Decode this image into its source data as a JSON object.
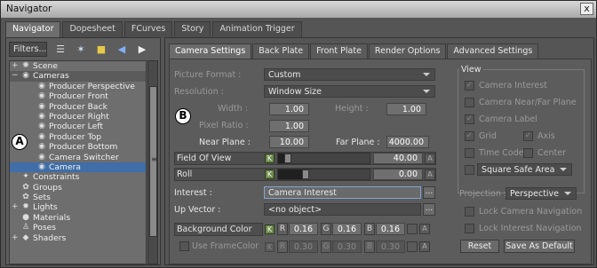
{
  "window": {
    "title": "Navigator",
    "close_glyph": "x"
  },
  "main_tabs": [
    {
      "label": "Navigator",
      "active": true
    },
    {
      "label": "Dopesheet",
      "active": false
    },
    {
      "label": "FCurves",
      "active": false
    },
    {
      "label": "Story",
      "active": false
    },
    {
      "label": "Animation Trigger",
      "active": false
    }
  ],
  "left": {
    "filters_label": "Filters...",
    "toolbar_icons": [
      "list-icon",
      "add-filter-icon",
      "lock-icon",
      "back-arrow-icon",
      "forward-arrow-icon"
    ],
    "tree": [
      {
        "label": "Scene",
        "indent": 0,
        "exp": "+",
        "icon": "scene-icon"
      },
      {
        "label": "Cameras",
        "indent": 0,
        "exp": "−",
        "icon": "camera-icon",
        "highlight": true
      },
      {
        "label": "Producer Perspective",
        "indent": 1,
        "exp": "",
        "icon": "camera-icon"
      },
      {
        "label": "Producer Front",
        "indent": 1,
        "exp": "",
        "icon": "camera-icon"
      },
      {
        "label": "Producer Back",
        "indent": 1,
        "exp": "",
        "icon": "camera-icon"
      },
      {
        "label": "Producer Right",
        "indent": 1,
        "exp": "",
        "icon": "camera-icon"
      },
      {
        "label": "Producer Left",
        "indent": 1,
        "exp": "",
        "icon": "camera-icon"
      },
      {
        "label": "Producer Top",
        "indent": 1,
        "exp": "",
        "icon": "camera-icon"
      },
      {
        "label": "Producer Bottom",
        "indent": 1,
        "exp": "",
        "icon": "camera-icon"
      },
      {
        "label": "Camera Switcher",
        "indent": 1,
        "exp": "",
        "icon": "camera-icon"
      },
      {
        "label": "Camera",
        "indent": 1,
        "exp": "",
        "icon": "camera-icon",
        "selected": true
      },
      {
        "label": "Constraints",
        "indent": 0,
        "exp": "",
        "icon": "constraint-icon"
      },
      {
        "label": "Groups",
        "indent": 0,
        "exp": "",
        "icon": "group-icon"
      },
      {
        "label": "Sets",
        "indent": 0,
        "exp": "",
        "icon": "set-icon"
      },
      {
        "label": "Lights",
        "indent": 0,
        "exp": "+",
        "icon": "light-icon"
      },
      {
        "label": "Materials",
        "indent": 0,
        "exp": "",
        "icon": "material-icon"
      },
      {
        "label": "Poses",
        "indent": 0,
        "exp": "",
        "icon": "pose-icon"
      },
      {
        "label": "Shaders",
        "indent": 0,
        "exp": "+",
        "icon": "shader-icon"
      }
    ],
    "badge_a": "A"
  },
  "sub_tabs": [
    {
      "label": "Camera Settings",
      "active": true
    },
    {
      "label": "Back Plate",
      "active": false
    },
    {
      "label": "Front Plate",
      "active": false
    },
    {
      "label": "Render Options",
      "active": false
    },
    {
      "label": "Advanced Settings",
      "active": false
    }
  ],
  "settings": {
    "badge_b": "B",
    "picture_format_label": "Picture Format :",
    "picture_format_value": "Custom",
    "resolution_label": "Resolution :",
    "resolution_value": "Window Size",
    "width_label": "Width :",
    "width_value": "1.00",
    "height_label": "Height :",
    "height_value": "1.00",
    "pixel_ratio_label": "Pixel Ratio :",
    "pixel_ratio_value": "1.00",
    "near_plane_label": "Near Plane :",
    "near_plane_value": "10.00",
    "far_plane_label": "Far Plane :",
    "far_plane_value": "4000.00",
    "fov_label": "Field Of View",
    "fov_value": "40.00",
    "fov_slider_fraction": 0.11,
    "roll_label": "Roll",
    "roll_value": "0.00",
    "roll_slider_fraction": 0.3,
    "key_glyph": "K",
    "arrow_glyph": "A",
    "interest_label": "Interest :",
    "interest_value": "Camera Interest",
    "up_vector_label": "Up Vector :",
    "up_vector_value": "<no object>",
    "dots": "...",
    "bg_color_label": "Background Color",
    "r_label": "R",
    "g_label": "G",
    "b_label": "B",
    "bg_r": "0.16",
    "bg_g": "0.16",
    "bg_b": "0.16",
    "frame_color_label": "Use FrameColor",
    "frame_r": "0.30",
    "frame_g": "0.30",
    "frame_b": "0.30"
  },
  "view": {
    "title": "View",
    "camera_interest": "Camera Interest",
    "camera_near_far": "Camera Near/Far Plane",
    "camera_label": "Camera Label",
    "grid": "Grid",
    "axis": "Axis",
    "time_code": "Time Code",
    "center": "Center",
    "safe_area": "Square Safe Area",
    "check_glyph": "✓"
  },
  "projection": {
    "label": "Projection :",
    "value": "Perspective"
  },
  "lock_camera_nav": "Lock Camera Navigation",
  "lock_interest_nav": "Lock Interest Navigation",
  "reset_label": "Reset",
  "save_default_label": "Save As Default"
}
